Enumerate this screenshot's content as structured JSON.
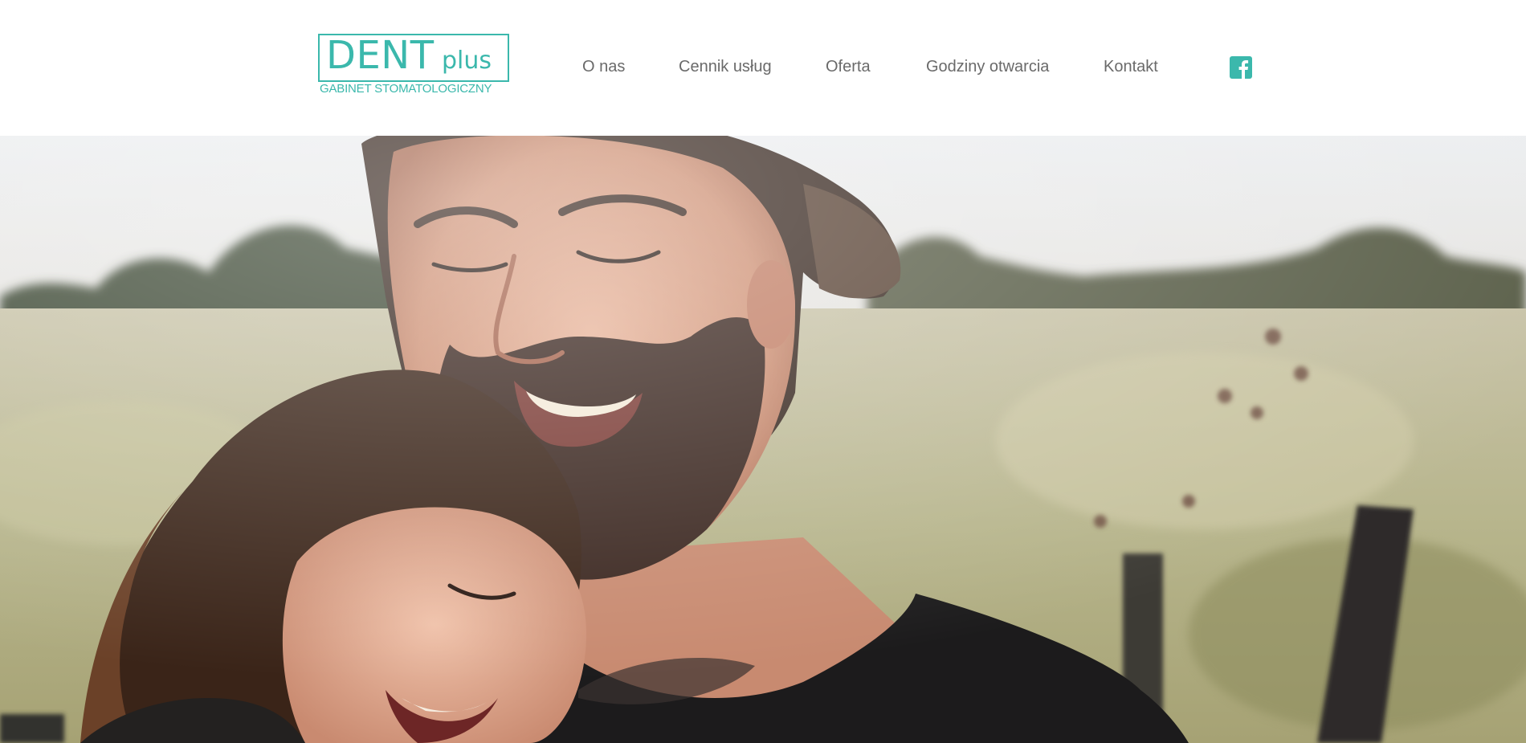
{
  "brand": {
    "name_main": "DENT",
    "name_suffix": "plus",
    "tagline": "GABINET STOMATOLOGICZNY",
    "accent_color": "#3bb8ac"
  },
  "nav": {
    "items": [
      {
        "label": "O nas"
      },
      {
        "label": "Cennik usług"
      },
      {
        "label": "Oferta"
      },
      {
        "label": "Godziny otwarcia"
      },
      {
        "label": "Kontakt"
      }
    ],
    "social_icon": "facebook-icon"
  },
  "hero": {
    "image": "photo-father-and-daughter-smiling-in-field"
  }
}
